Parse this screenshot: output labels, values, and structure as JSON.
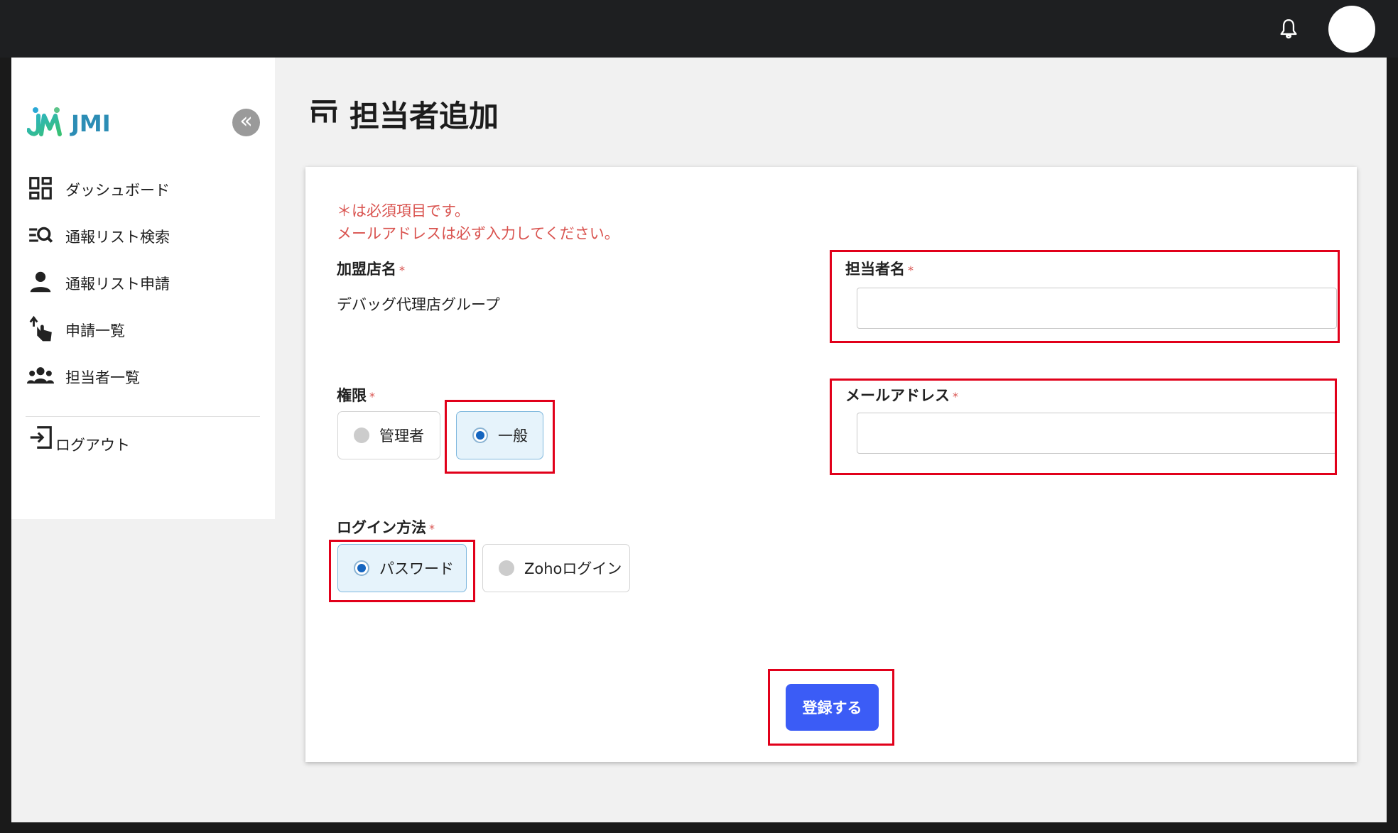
{
  "topbar": {
    "bell_icon": "bell-icon",
    "avatar": "user-avatar"
  },
  "sidebar": {
    "logo_text": "JMI",
    "collapse_symbol": "«",
    "items": [
      {
        "label": "ダッシュボード",
        "icon": "dashboard-icon"
      },
      {
        "label": "通報リスト検索",
        "icon": "list-search-icon"
      },
      {
        "label": "通報リスト申請",
        "icon": "person-icon"
      },
      {
        "label": "申請一覧",
        "icon": "hand-pointer-icon"
      },
      {
        "label": "担当者一覧",
        "icon": "group-icon"
      }
    ],
    "logout_label": "ログアウト"
  },
  "page": {
    "title": "担当者追加",
    "title_icon": "store-icon"
  },
  "form": {
    "note_required": "＊は必須項目です。",
    "note_email": "メールアドレスは必ず入力してください。",
    "required_mark": "*",
    "store_label": "加盟店名",
    "store_value": "デバッグ代理店グループ",
    "name_label": "担当者名",
    "name_value": "",
    "email_label": "メールアドレス",
    "email_value": "",
    "role_label": "権限",
    "role_options": [
      {
        "label": "管理者",
        "selected": false
      },
      {
        "label": "一般",
        "selected": true
      }
    ],
    "login_label": "ログイン方法",
    "login_options": [
      {
        "label": "パスワード",
        "selected": true
      },
      {
        "label": "Zohoログイン",
        "selected": false
      }
    ],
    "submit_label": "登録する"
  },
  "colors": {
    "accent": "#3b5cf6",
    "required": "#d9534f",
    "highlight": "#e1001a",
    "topbar": "#1e1f21"
  }
}
